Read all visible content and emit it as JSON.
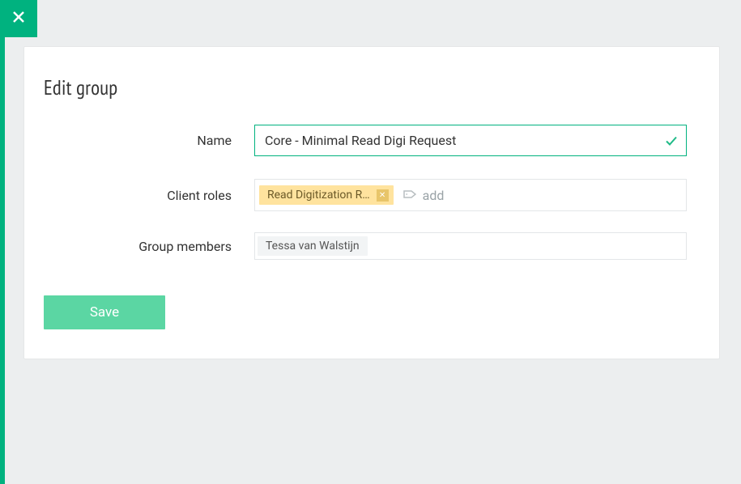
{
  "page": {
    "title": "Edit group"
  },
  "labels": {
    "name": "Name",
    "client_roles": "Client roles",
    "group_members": "Group members"
  },
  "fields": {
    "name_value": "Core - Minimal Read Digi Request",
    "client_roles": [
      {
        "label": "Read Digitization R…"
      }
    ],
    "add_placeholder": "add",
    "group_members": [
      {
        "name": "Tessa van Walstijn"
      }
    ]
  },
  "actions": {
    "save_label": "Save"
  },
  "colors": {
    "accent": "#00b27f",
    "tag_bg": "#ffe49f"
  }
}
